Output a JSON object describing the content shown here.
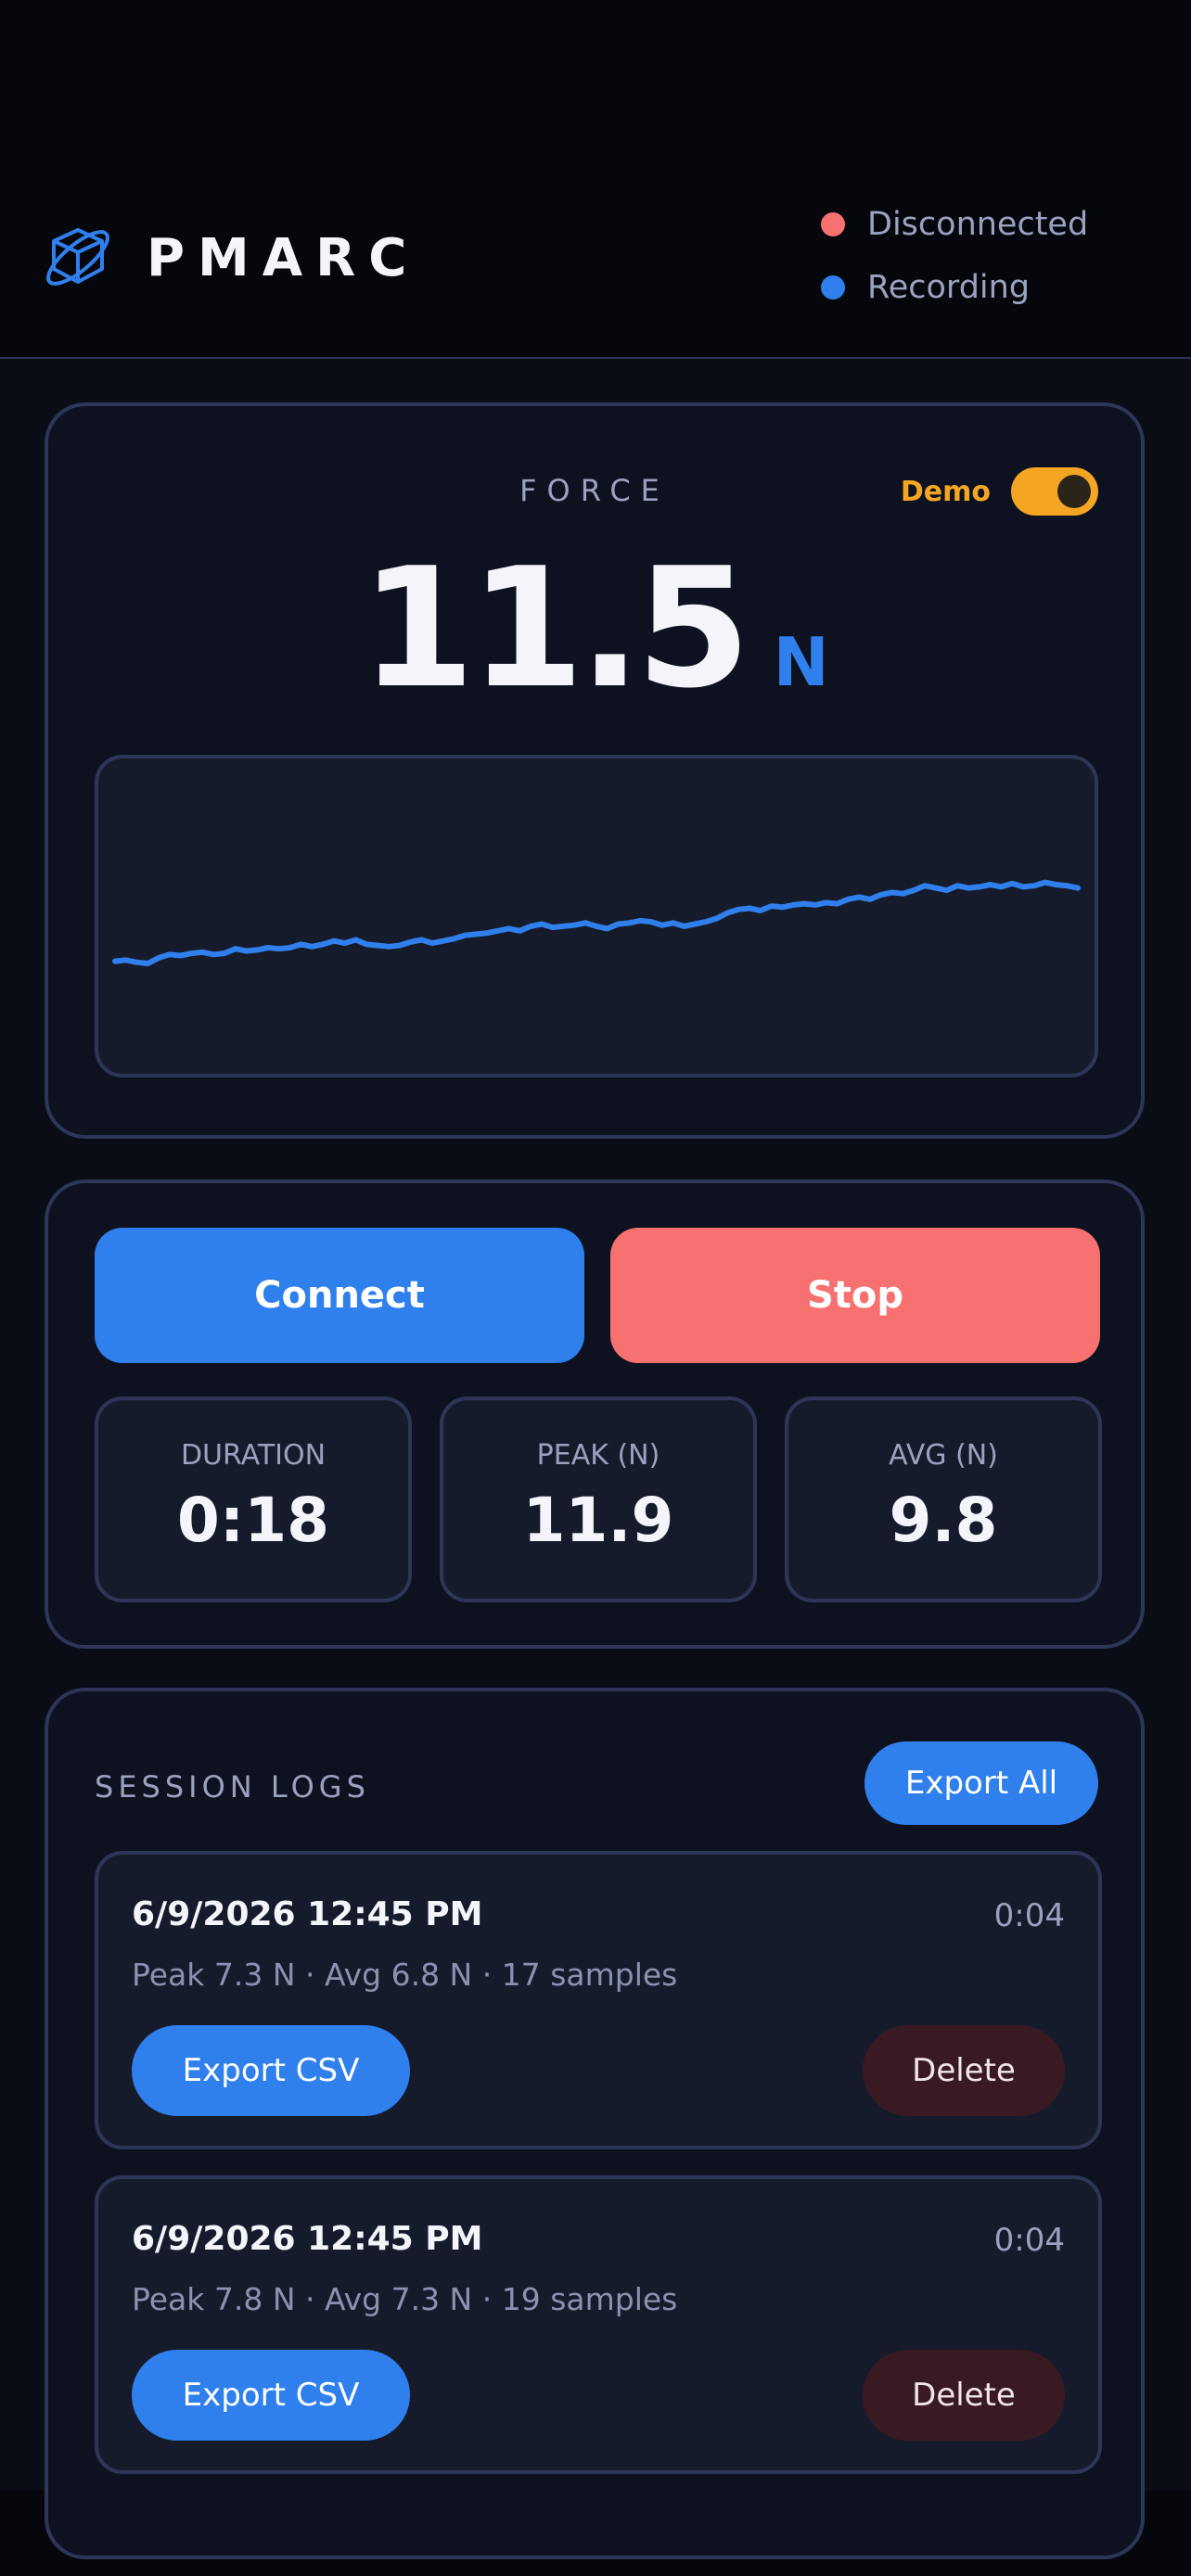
{
  "header": {
    "brand": "PMARC",
    "status": [
      {
        "label": "Disconnected",
        "color": "#f87171"
      },
      {
        "label": "Recording",
        "color": "#2f80ed"
      }
    ]
  },
  "force_card": {
    "label": "FORCE",
    "demo_label": "Demo",
    "demo_enabled": true,
    "value": "11.5",
    "unit": "N"
  },
  "chart_data": {
    "type": "line",
    "series": [
      {
        "values": [
          5.0,
          5.05,
          4.95,
          4.9,
          5.15,
          5.3,
          5.25,
          5.35,
          5.4,
          5.3,
          5.35,
          5.55,
          5.45,
          5.5,
          5.6,
          5.55,
          5.6,
          5.75,
          5.65,
          5.75,
          5.9,
          5.8,
          5.95,
          5.75,
          5.7,
          5.65,
          5.7,
          5.85,
          5.95,
          5.8,
          5.9,
          6.0,
          6.15,
          6.2,
          6.25,
          6.35,
          6.45,
          6.35,
          6.55,
          6.65,
          6.5,
          6.55,
          6.6,
          6.7,
          6.55,
          6.45,
          6.65,
          6.7,
          6.8,
          6.75,
          6.6,
          6.7,
          6.55,
          6.65,
          6.75,
          6.9,
          7.15,
          7.3,
          7.35,
          7.25,
          7.45,
          7.4,
          7.5,
          7.55,
          7.5,
          7.6,
          7.55,
          7.75,
          7.85,
          7.75,
          7.95,
          8.05,
          8.0,
          8.15,
          8.35,
          8.25,
          8.15,
          8.35,
          8.25,
          8.3,
          8.4,
          8.3,
          8.45,
          8.3,
          8.35,
          8.5,
          8.4,
          8.35,
          8.25
        ]
      }
    ],
    "ylim": [
      0,
      14
    ],
    "grid": false,
    "color": "#2f80ed"
  },
  "controls": {
    "connect_label": "Connect",
    "stop_label": "Stop",
    "stats": [
      {
        "label": "DURATION",
        "value": "0:18"
      },
      {
        "label": "PEAK (N)",
        "value": "11.9"
      },
      {
        "label": "AVG (N)",
        "value": "9.8"
      }
    ]
  },
  "logs": {
    "title": "SESSION LOGS",
    "export_all_label": "Export All",
    "items": [
      {
        "date": "6/9/2026 12:45 PM",
        "duration": "0:04",
        "meta": "Peak 7.3 N · Avg 6.8 N · 17 samples",
        "export_label": "Export CSV",
        "delete_label": "Delete"
      },
      {
        "date": "6/9/2026 12:45 PM",
        "duration": "0:04",
        "meta": "Peak 7.8 N · Avg 7.3 N · 19 samples",
        "export_label": "Export CSV",
        "delete_label": "Delete"
      }
    ]
  }
}
